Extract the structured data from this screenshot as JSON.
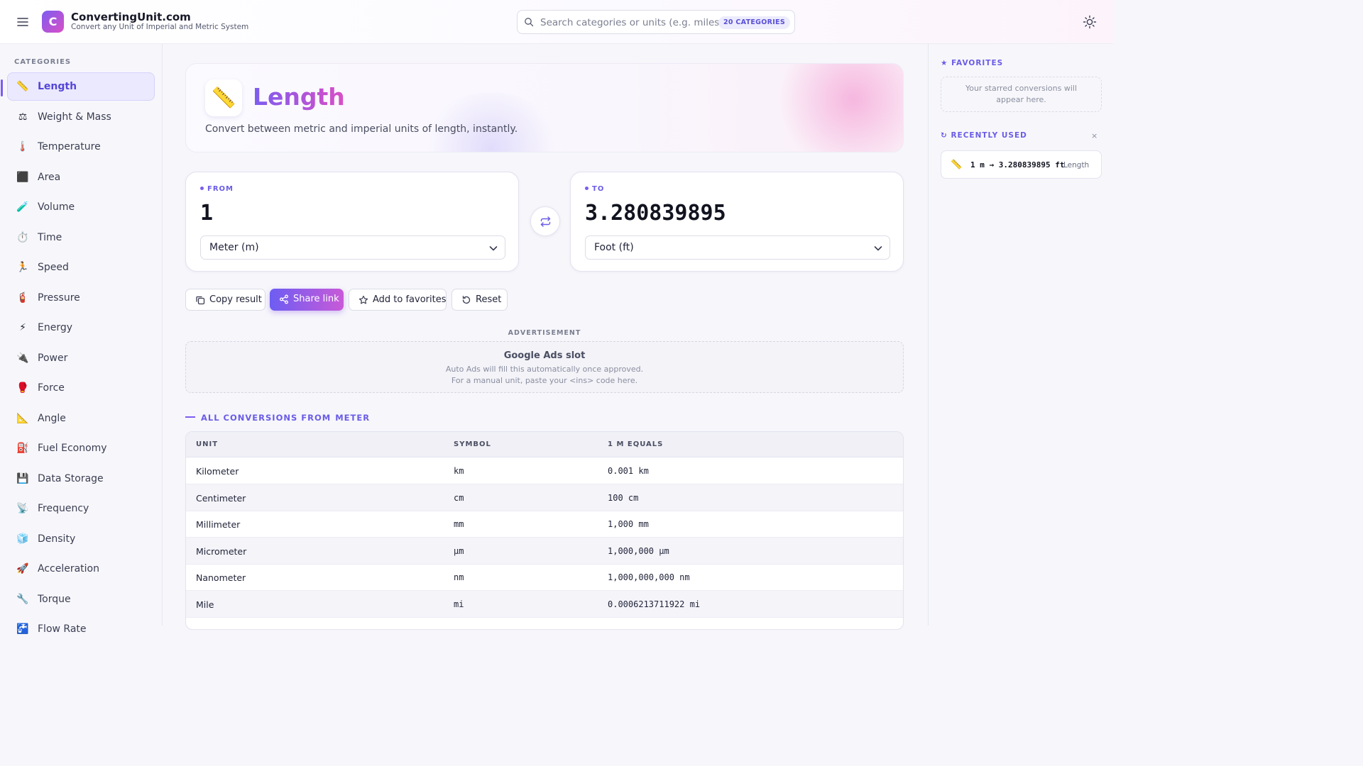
{
  "header": {
    "logo_letter": "C",
    "brand": "ConvertingUnit.com",
    "tagline": "Convert any Unit of Imperial and Metric System",
    "search_placeholder": "Search categories or units (e.g. miles, kg, °F)",
    "categories_badge": "20 CATEGORIES",
    "icons": {
      "menu": "hamburger-icon",
      "search": "search-icon",
      "theme": "sun-icon"
    }
  },
  "sidebar": {
    "heading": "CATEGORIES",
    "items": [
      {
        "icon": "📏",
        "label": "Length",
        "active": true
      },
      {
        "icon": "⚖",
        "label": "Weight & Mass"
      },
      {
        "icon": "🌡️",
        "label": "Temperature"
      },
      {
        "icon": "⬛",
        "label": "Area"
      },
      {
        "icon": "🧪",
        "label": "Volume"
      },
      {
        "icon": "⏱️",
        "label": "Time"
      },
      {
        "icon": "🏃",
        "label": "Speed"
      },
      {
        "icon": "🧯",
        "label": "Pressure"
      },
      {
        "icon": "⚡",
        "label": "Energy"
      },
      {
        "icon": "🔌",
        "label": "Power"
      },
      {
        "icon": "🥊",
        "label": "Force"
      },
      {
        "icon": "📐",
        "label": "Angle"
      },
      {
        "icon": "⛽",
        "label": "Fuel Economy"
      },
      {
        "icon": "💾",
        "label": "Data Storage"
      },
      {
        "icon": "📡",
        "label": "Frequency"
      },
      {
        "icon": "🧊",
        "label": "Density"
      },
      {
        "icon": "🚀",
        "label": "Acceleration"
      },
      {
        "icon": "🔧",
        "label": "Torque"
      },
      {
        "icon": "🚰",
        "label": "Flow Rate"
      }
    ]
  },
  "hero": {
    "icon": "📏",
    "title": "Length",
    "description": "Convert between metric and imperial units of length, instantly."
  },
  "converter": {
    "from_label": "FROM",
    "from_value": "1",
    "from_unit": "Meter (m)",
    "to_label": "TO",
    "to_value": "3.280839895",
    "to_unit": "Foot (ft)",
    "icons": {
      "swap": "swap-arrows-icon",
      "dropdown": "chevron-down-icon"
    }
  },
  "actions": {
    "copy": "Copy result",
    "share": "Share link",
    "favorite": "Add to favorites",
    "reset": "Reset"
  },
  "ad": {
    "label": "ADVERTISEMENT",
    "title": "Google Ads slot",
    "line1": "Auto Ads will fill this automatically once approved.",
    "line2": "For a manual unit, paste your <ins> code here."
  },
  "conversions": {
    "heading": "ALL CONVERSIONS FROM",
    "from_unit": "METER",
    "columns": [
      "UNIT",
      "SYMBOL",
      "1 M EQUALS"
    ],
    "rows": [
      {
        "unit": "Kilometer",
        "symbol": "km",
        "equals": "0.001 km"
      },
      {
        "unit": "Centimeter",
        "symbol": "cm",
        "equals": "100 cm"
      },
      {
        "unit": "Millimeter",
        "symbol": "mm",
        "equals": "1,000 mm"
      },
      {
        "unit": "Micrometer",
        "symbol": "µm",
        "equals": "1,000,000 µm"
      },
      {
        "unit": "Nanometer",
        "symbol": "nm",
        "equals": "1,000,000,000 nm"
      },
      {
        "unit": "Mile",
        "symbol": "mi",
        "equals": "0.0006213711922 mi"
      }
    ]
  },
  "right_panel": {
    "favorites_heading": "★ FAVORITES",
    "favorites_empty": "Your starred conversions will appear here.",
    "recent_heading": "↻ RECENTLY USED",
    "clear_symbol": "×",
    "recent": [
      {
        "icon": "📏",
        "conversion": "1 m → 3.280839895 ft",
        "category": "Length"
      }
    ]
  }
}
